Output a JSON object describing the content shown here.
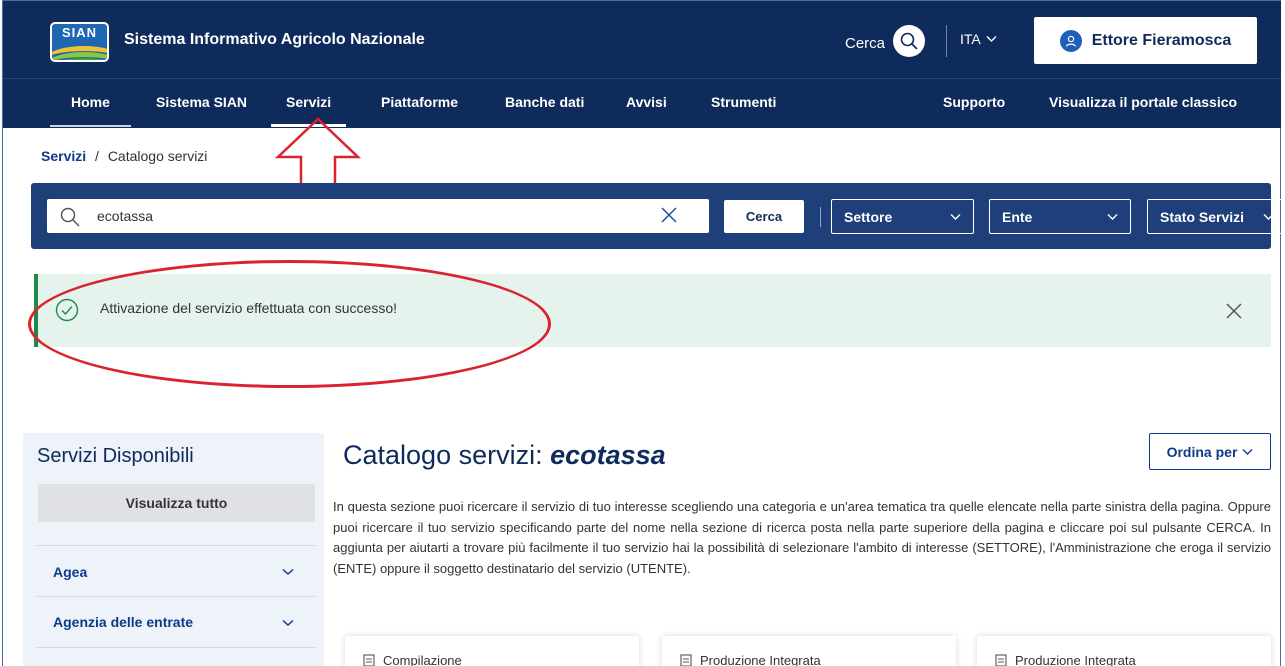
{
  "header": {
    "logo_text": "SIAN",
    "site_title": "Sistema Informativo Agricolo Nazionale",
    "search_label": "Cerca",
    "language": "ITA",
    "user_name": "Ettore Fieramosca"
  },
  "nav": {
    "items": [
      "Home",
      "Sistema SIAN",
      "Servizi",
      "Piattaforme",
      "Banche dati",
      "Avvisi",
      "Strumenti"
    ],
    "support": "Supporto",
    "classic": "Visualizza il portale classico",
    "active": "Servizi"
  },
  "breadcrumb": {
    "link": "Servizi",
    "separator": "/",
    "current": "Catalogo servizi"
  },
  "searchbar": {
    "value": "ecotassa",
    "button": "Cerca",
    "filters": [
      "Settore",
      "Ente",
      "Stato Servizi"
    ]
  },
  "alert": {
    "message": "Attivazione del servizio effettuata con successo!"
  },
  "sidebar": {
    "title": "Servizi Disponibili",
    "show_all": "Visualizza tutto",
    "items": [
      "Agea",
      "Agenzia delle entrate"
    ]
  },
  "main": {
    "title_prefix": "Catalogo servizi:",
    "title_query": "ecotassa",
    "order_button": "Ordina per",
    "intro": "In questa sezione puoi ricercare il servizio di tuo interesse scegliendo una categoria e un'area tematica tra quelle elencate nella parte sinistra della pagina. Oppure puoi ricercare il tuo servizio specificando parte del nome nella sezione di ricerca posta nella parte superiore della pagina e cliccare poi sul pulsante CERCA. In aggiunta per aiutarti a trovare più facilmente il tuo servizio hai la possibilità di selezionare l'ambito di interesse (SETTORE), l'Amministrazione che eroga il servizio (ENTE) oppure il soggetto destinatario del servizio (UTENTE).",
    "cards": [
      "Compilazione",
      "Produzione Integrata",
      "Produzione Integrata"
    ]
  },
  "colors": {
    "header_bg": "#0f2b5b",
    "search_band_bg": "#1e3f7a",
    "alert_bg": "#e6f3ec",
    "alert_border": "#1d8a4a",
    "annotation_red": "#d9232e"
  },
  "annotations": {
    "arrow": "red-outline-arrow-pointing-up",
    "ellipse": "red-ellipse-around-alert"
  }
}
